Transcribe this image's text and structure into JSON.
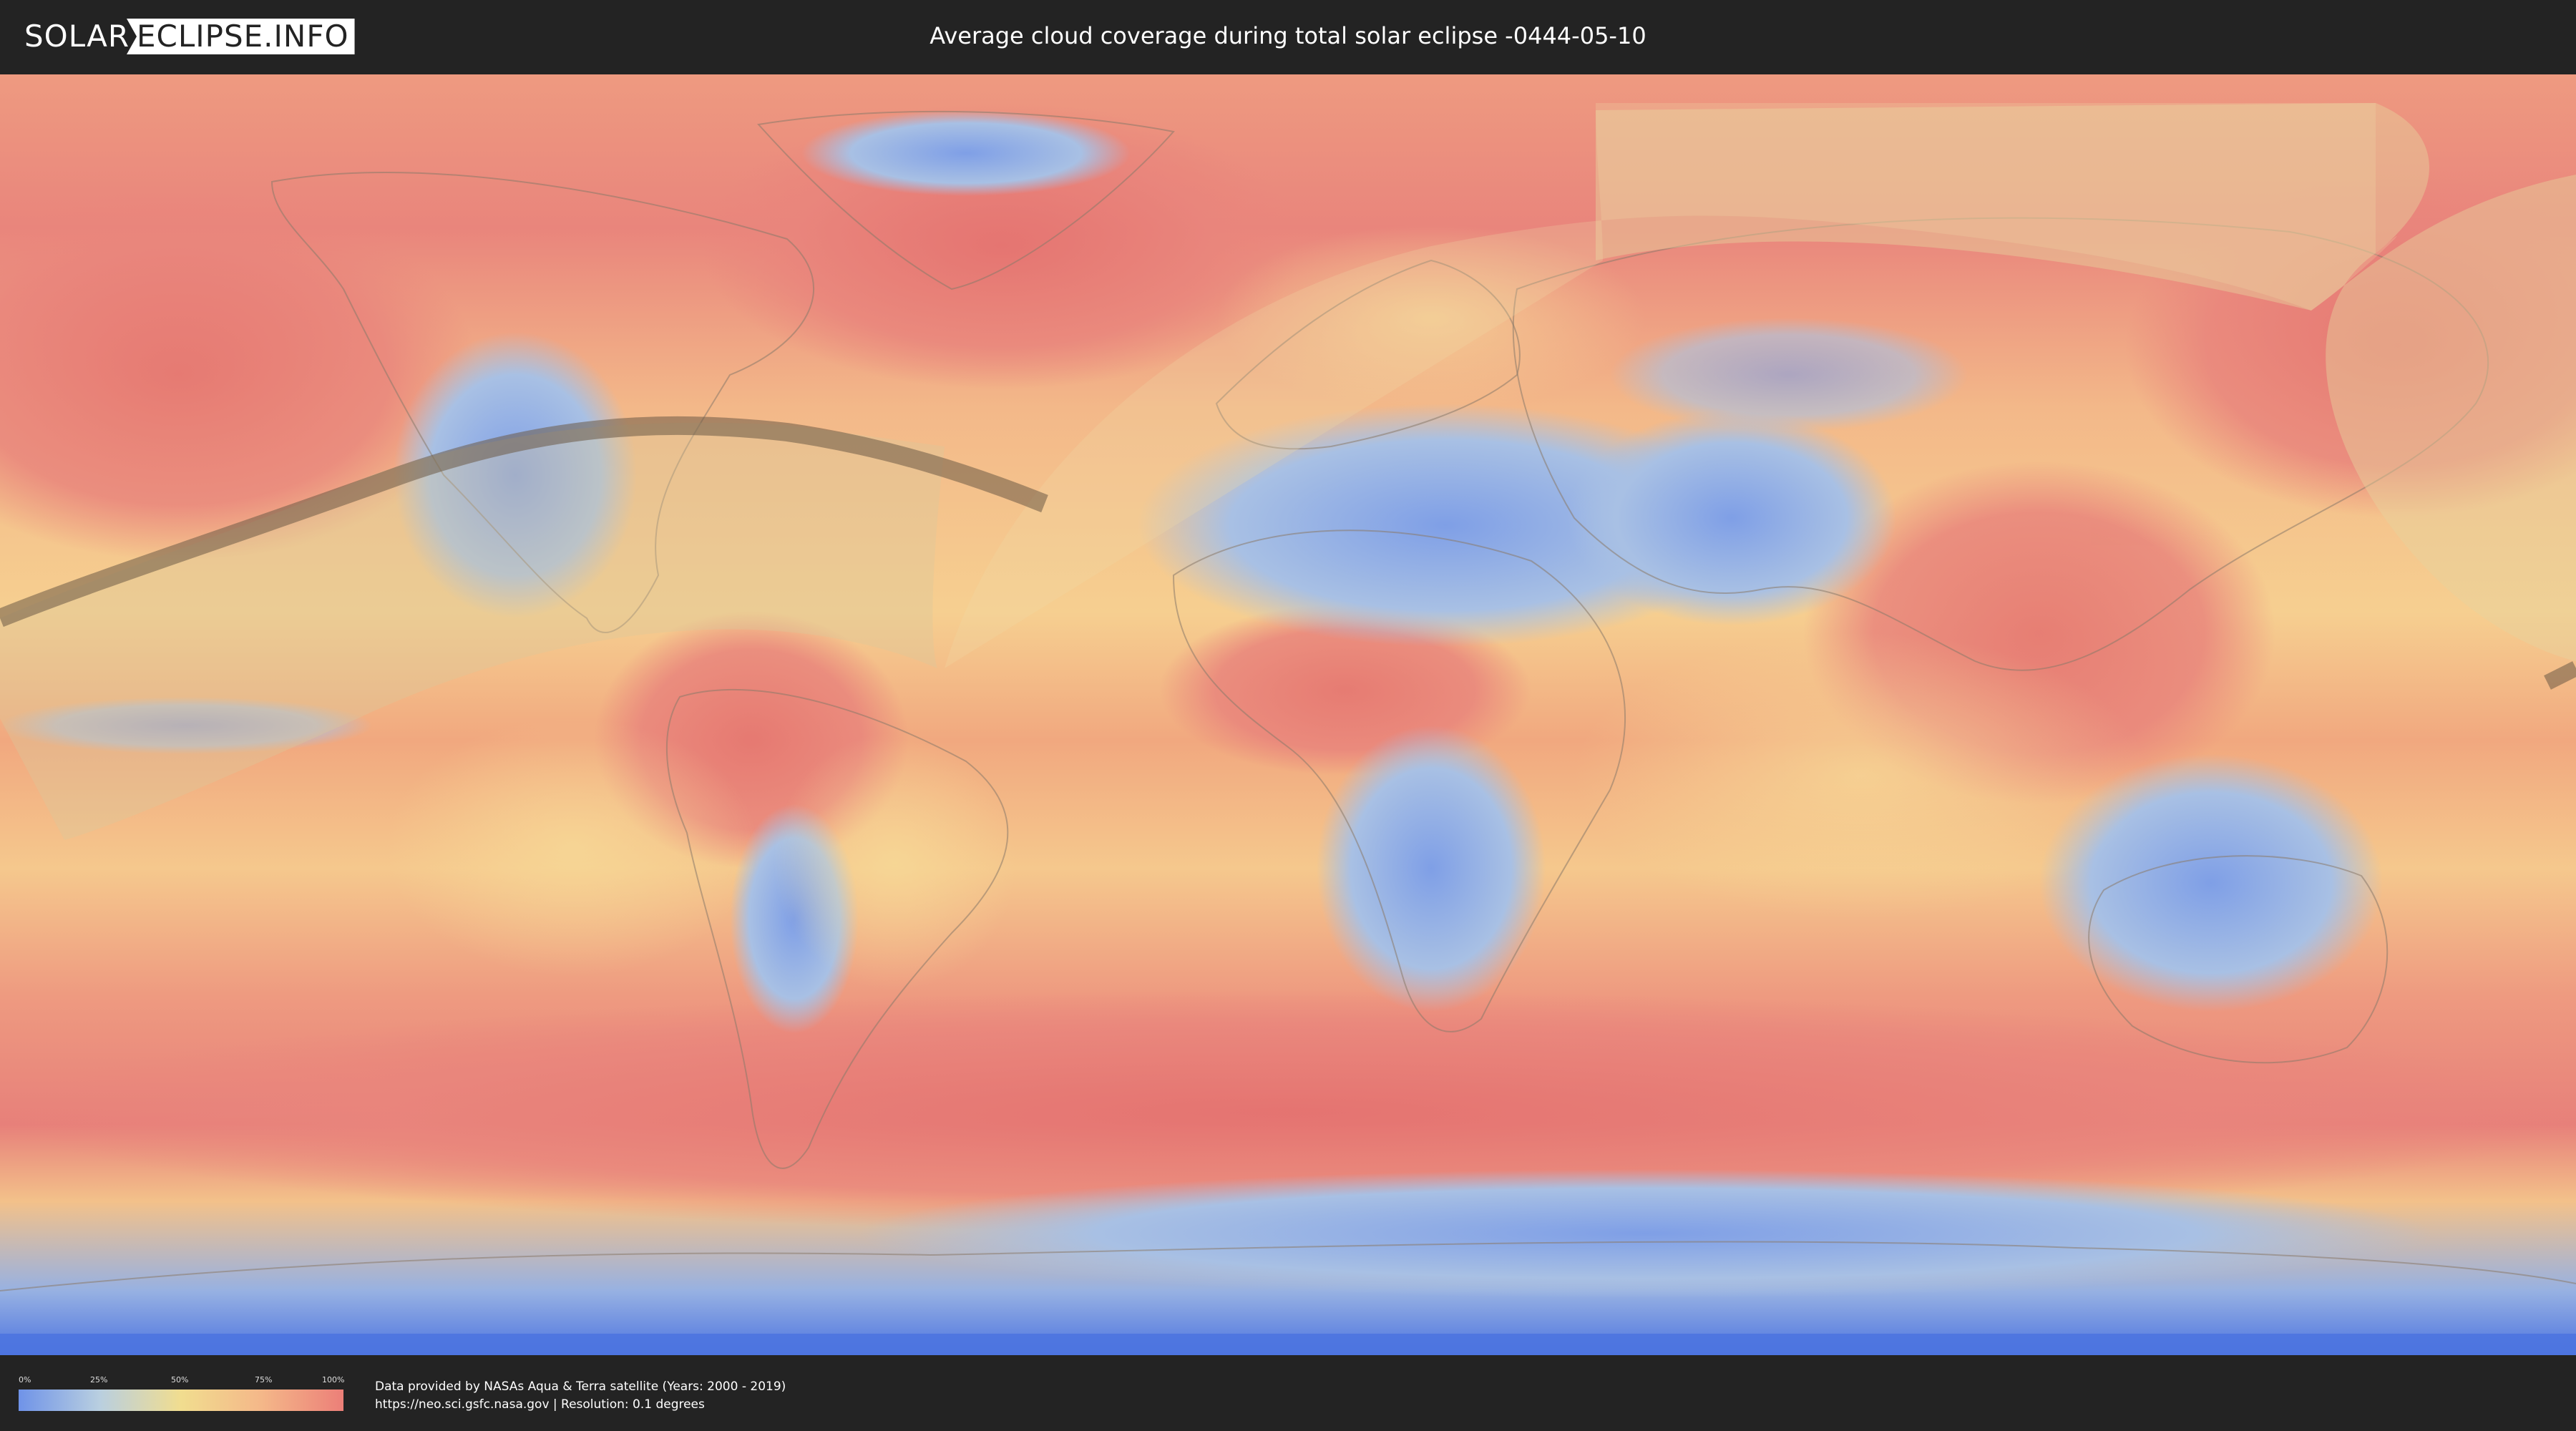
{
  "header": {
    "logo_left": "SOLAR",
    "logo_right": "ECLIPSE.INFO",
    "title": "Average cloud coverage during total solar eclipse -0444-05-10"
  },
  "legend": {
    "ticks": [
      "0%",
      "25%",
      "50%",
      "75%",
      "100%"
    ],
    "colors": {
      "low": "#6f93e8",
      "mid": "#f1dd8f",
      "high": "#ec7f78"
    }
  },
  "footer": {
    "credit_line1": "Data provided by NASAs Aqua & Terra satellite (Years: 2000 - 2019)",
    "credit_line2": "https://neo.sci.gsfc.nasa.gov | Resolution: 0.1 degrees"
  },
  "map": {
    "colors": {
      "cloudy": "#e9857c",
      "moderate": "#f5c98e",
      "clear": "#8aa8e6",
      "eclipse_zone": "#f2dca0",
      "eclipse_path": "#6b5a45",
      "borders": "#8a7a6a"
    }
  }
}
